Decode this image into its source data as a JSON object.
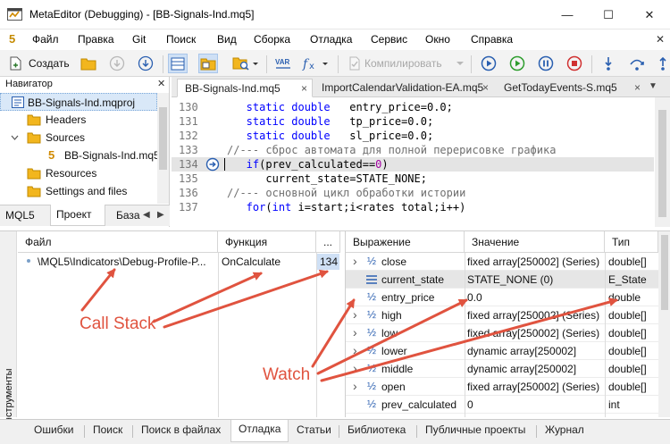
{
  "window": {
    "title": "MetaEditor (Debugging) - [BB-Signals-Ind.mq5]",
    "minimize": "—",
    "maximize": "☐",
    "close": "✕"
  },
  "menu": {
    "logo": "5",
    "items": [
      "Файл",
      "Правка",
      "Git",
      "Поиск",
      "Вид",
      "Сборка",
      "Отладка",
      "Сервис",
      "Окно",
      "Справка"
    ],
    "close_glyph": "✕"
  },
  "toolbar": {
    "create_label": "Создать",
    "compile_label": "Компилировать"
  },
  "navigator": {
    "title": "Навигатор",
    "close_glyph": "✕",
    "items": [
      {
        "label": "BB-Signals-Ind.mqproj",
        "icon": "project-icon"
      },
      {
        "label": "Headers",
        "icon": "folder-icon"
      },
      {
        "label": "Sources",
        "icon": "folder-icon"
      },
      {
        "label": "BB-Signals-Ind.mq5",
        "icon": "mq5-file-icon"
      },
      {
        "label": "Resources",
        "icon": "folder-icon"
      },
      {
        "label": "Settings and files",
        "icon": "folder-icon"
      }
    ],
    "file_icon_glyph": "5",
    "tabs": [
      "MQL5",
      "Проект",
      "База"
    ]
  },
  "editor": {
    "tabs": [
      {
        "label": "BB-Signals-Ind.mq5",
        "close": "×"
      },
      {
        "label": "ImportCalendarValidation-EA.mq5",
        "close": "×"
      },
      {
        "label": "GetTodayEvents-S.mq5",
        "close": "×"
      }
    ],
    "lines": [
      {
        "n": "130",
        "parts": [
          [
            "kw",
            "   static double"
          ],
          [
            "vr",
            "   entry_price=0.0;"
          ]
        ]
      },
      {
        "n": "131",
        "parts": [
          [
            "kw",
            "   static double"
          ],
          [
            "vr",
            "   tp_price=0.0;"
          ]
        ]
      },
      {
        "n": "132",
        "parts": [
          [
            "kw",
            "   static double"
          ],
          [
            "vr",
            "   sl_price=0.0;"
          ]
        ]
      },
      {
        "n": "133",
        "parts": [
          [
            "cm",
            "//--- сброс автомата для полной перерисовке графика"
          ]
        ]
      },
      {
        "n": "134",
        "parts": [
          [
            "kw",
            "   if"
          ],
          [
            "vr",
            "(prev_calculated=="
          ],
          [
            "nm",
            "0"
          ],
          [
            "vr",
            ")"
          ]
        ]
      },
      {
        "n": "135",
        "parts": [
          [
            "vr",
            "      current_state=STATE_NONE;"
          ]
        ]
      },
      {
        "n": "136",
        "parts": [
          [
            "cm",
            "//--- основной цикл обработки истории"
          ]
        ]
      },
      {
        "n": "137",
        "parts": [
          [
            "kw",
            "   for"
          ],
          [
            "vr",
            "("
          ],
          [
            "kw",
            "int"
          ],
          [
            "vr",
            " i=start;i<rates total;i++)"
          ]
        ]
      }
    ]
  },
  "callstack": {
    "columns": [
      "Файл",
      "Функция",
      "..."
    ],
    "rows": [
      {
        "file": "\\MQL5\\Indicators\\Debug-Profile-P...",
        "function": "OnCalculate",
        "line": "134"
      }
    ]
  },
  "watch": {
    "columns": [
      "Выражение",
      "Значение",
      "Тип"
    ],
    "expand_glyph": "›",
    "int_icon_glyph": "½",
    "rows": [
      {
        "name": "close",
        "value": "fixed array[250002] (Series)",
        "type": "double[]",
        "expandable": true,
        "icon": "half-icon"
      },
      {
        "name": "current_state",
        "value": "STATE_NONE (0)",
        "type": "E_State",
        "expandable": false,
        "icon": "enum-icon"
      },
      {
        "name": "entry_price",
        "value": "0.0",
        "type": "double",
        "expandable": false,
        "icon": "half-icon"
      },
      {
        "name": "high",
        "value": "fixed array[250002] (Series)",
        "type": "double[]",
        "expandable": true,
        "icon": "half-icon"
      },
      {
        "name": "low",
        "value": "fixed array[250002] (Series)",
        "type": "double[]",
        "expandable": true,
        "icon": "half-icon"
      },
      {
        "name": "lower",
        "value": "dynamic array[250002]",
        "type": "double[]",
        "expandable": true,
        "icon": "half-icon"
      },
      {
        "name": "middle",
        "value": "dynamic array[250002]",
        "type": "double[]",
        "expandable": true,
        "icon": "half-icon"
      },
      {
        "name": "open",
        "value": "fixed array[250002] (Series)",
        "type": "double[]",
        "expandable": true,
        "icon": "half-icon"
      },
      {
        "name": "prev_calculated",
        "value": "0",
        "type": "int",
        "expandable": false,
        "icon": "int-icon"
      }
    ]
  },
  "side_label": "Инструменты",
  "bottom_tabs": [
    "Ошибки",
    "Поиск",
    "Поиск в файлах",
    "Отладка",
    "Статьи",
    "Библиотека",
    "Публичные проекты",
    "Журнал"
  ],
  "annotations": {
    "callstack": "Call Stack",
    "watch": "Watch"
  },
  "colors": {
    "accent": "#e0533f",
    "keyword": "#0000ff",
    "comment": "#707070"
  }
}
